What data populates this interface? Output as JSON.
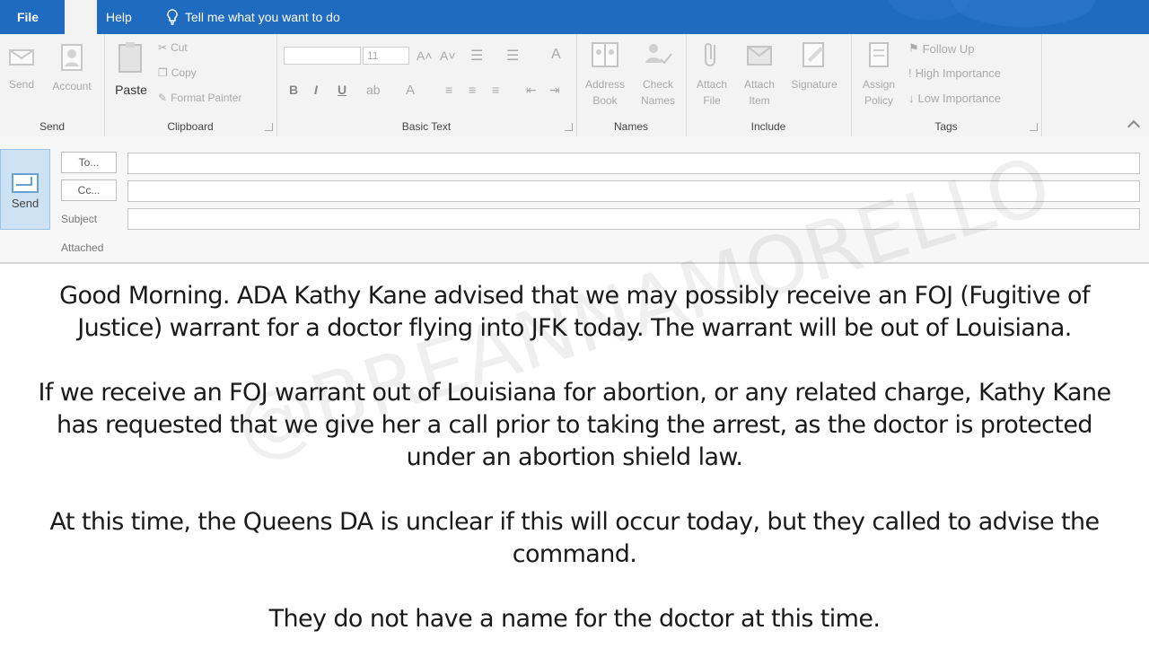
{
  "tabs": {
    "file": "File",
    "help": "Help",
    "tell_me": "Tell me what you want to do"
  },
  "ribbon": {
    "send_group": {
      "label": "Send",
      "send": "Send",
      "account": "Account"
    },
    "clipboard": {
      "label": "Clipboard",
      "paste": "Paste",
      "cut": "Cut",
      "copy": "Copy",
      "format_painter": "Format Painter"
    },
    "basic_text": {
      "label": "Basic Text",
      "font_size": "11",
      "bold": "B",
      "italic": "I",
      "underline": "U"
    },
    "names": {
      "label": "Names",
      "address_book_1": "Address",
      "address_book_2": "Book",
      "check_names_1": "Check",
      "check_names_2": "Names"
    },
    "include": {
      "label": "Include",
      "attach_file_1": "Attach",
      "attach_file_2": "File",
      "attach_item_1": "Attach",
      "attach_item_2": "Item",
      "signature": "Signature"
    },
    "tags": {
      "label": "Tags",
      "assign_policy_1": "Assign",
      "assign_policy_2": "Policy",
      "follow_up": "Follow Up",
      "high_importance": "High Importance",
      "low_importance": "Low Importance"
    }
  },
  "header": {
    "send": "Send",
    "to": "To...",
    "cc": "Cc...",
    "subject": "Subject",
    "attached": "Attached"
  },
  "body": {
    "p1_line1": "Good Morning. ADA Kathy Kane advised that we may possibly receive an FOJ (Fugitive of",
    "p1_line2": "Justice) warrant for a doctor flying into JFK today. The warrant will be out of Louisiana.",
    "p2_line1": "If we receive an FOJ warrant out of Louisiana for abortion, or any related charge, Kathy Kane",
    "p2_line2": "has requested that we give her a call prior to taking the arrest, as the doctor is protected",
    "p2_line3": "under an abortion shield law.",
    "p3_line1": "At this time, the Queens DA is unclear if this will occur today, but they called to advise the",
    "p3_line2": "command.",
    "p4_line1": "They do not have a name for the doctor at this time."
  },
  "watermark": "@BREANNAMORELLO"
}
